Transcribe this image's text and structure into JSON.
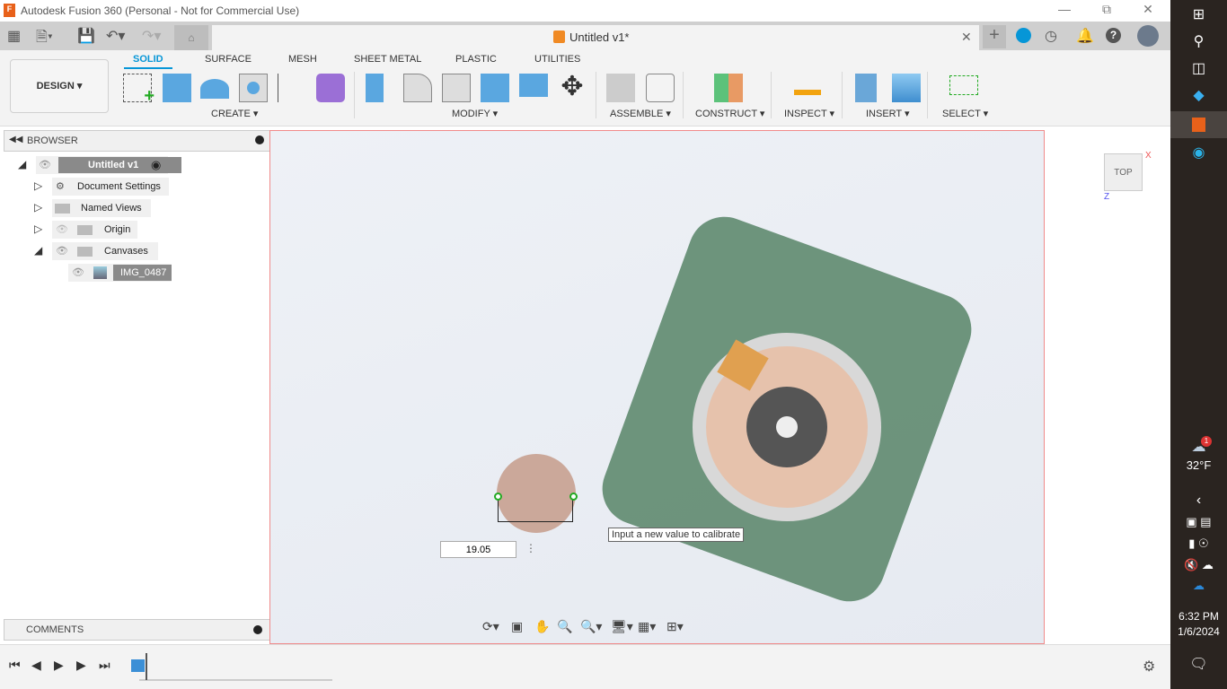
{
  "window": {
    "title": "Autodesk Fusion 360 (Personal - Not for Commercial Use)",
    "app_icon_letter": "F"
  },
  "document_tab": {
    "title": "Untitled v1*"
  },
  "workspace": {
    "label": "DESIGN ▾"
  },
  "ribbon_tabs": [
    {
      "label": "SOLID",
      "active": true
    },
    {
      "label": "SURFACE"
    },
    {
      "label": "MESH"
    },
    {
      "label": "SHEET METAL"
    },
    {
      "label": "PLASTIC"
    },
    {
      "label": "UTILITIES"
    }
  ],
  "groups": {
    "create": "CREATE ▾",
    "modify": "MODIFY ▾",
    "assemble": "ASSEMBLE ▾",
    "construct": "CONSTRUCT ▾",
    "inspect": "INSPECT ▾",
    "insert": "INSERT ▾",
    "select": "SELECT ▾"
  },
  "browser": {
    "title": "BROWSER",
    "root": "Untitled v1",
    "items": [
      "Document Settings",
      "Named Views",
      "Origin",
      "Canvases"
    ],
    "canvas_item": "IMG_0487"
  },
  "comments": {
    "title": "COMMENTS"
  },
  "calibrate": {
    "value": "19.05",
    "tooltip": "Input a new value to calibrate"
  },
  "viewcube": {
    "face": "TOP",
    "x": "X",
    "z": "Z"
  },
  "taskbar": {
    "weather": "32°F",
    "weather_badge": "1",
    "time": "6:32 PM",
    "date": "1/6/2024"
  },
  "colors": {
    "accent": "#0696d7",
    "canvas_border": "#f08a8a",
    "taskbar": "#2a2420"
  }
}
